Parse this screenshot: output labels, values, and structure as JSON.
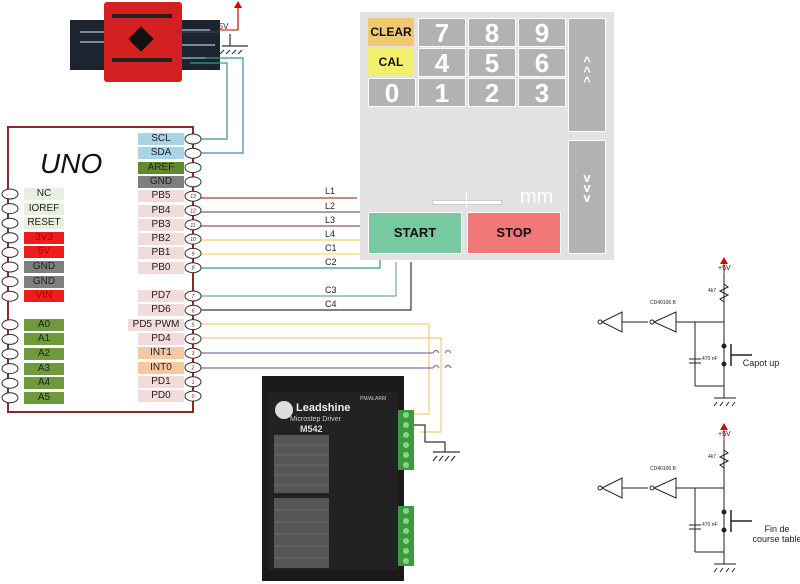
{
  "board": {
    "title": "UNO"
  },
  "left_pins": [
    {
      "label": "NC",
      "color": "#e8efe0",
      "text": "#222"
    },
    {
      "label": "IOREF",
      "color": "#e8efe0",
      "text": "#222"
    },
    {
      "label": "RESET",
      "color": "#e8efe0",
      "text": "#222"
    },
    {
      "label": "3V3",
      "color": "#ee1c1c",
      "text": "#a00"
    },
    {
      "label": "5V",
      "color": "#ee1c1c",
      "text": "#a00"
    },
    {
      "label": "GND",
      "color": "#7f7f7f",
      "text": "#222"
    },
    {
      "label": "GND",
      "color": "#7f7f7f",
      "text": "#222"
    },
    {
      "label": "VIN",
      "color": "#ee1c1c",
      "text": "#a00"
    },
    {
      "label": "A0",
      "color": "#6e9a3c",
      "text": "#222"
    },
    {
      "label": "A1",
      "color": "#6e9a3c",
      "text": "#222"
    },
    {
      "label": "A2",
      "color": "#6e9a3c",
      "text": "#222"
    },
    {
      "label": "A3",
      "color": "#6e9a3c",
      "text": "#222"
    },
    {
      "label": "A4",
      "color": "#6e9a3c",
      "text": "#222"
    },
    {
      "label": "A5",
      "color": "#6e9a3c",
      "text": "#222"
    }
  ],
  "right_pins": [
    {
      "label": "SCL",
      "color": "#a8d4e6",
      "num": ""
    },
    {
      "label": "SDA",
      "color": "#a8d4e6",
      "num": ""
    },
    {
      "label": "AREF",
      "color": "#5f8a2e",
      "num": ""
    },
    {
      "label": "GND",
      "color": "#7f7f7f",
      "num": ""
    },
    {
      "label": "PB5",
      "color": "#f2dcdb",
      "num": "13"
    },
    {
      "label": "PB4",
      "color": "#f2dcdb",
      "num": "12"
    },
    {
      "label": "PB3",
      "color": "#f2dcdb",
      "num": "11"
    },
    {
      "label": "PB2",
      "color": "#f2dcdb",
      "num": "10"
    },
    {
      "label": "PB1",
      "color": "#f2dcdb",
      "num": "9"
    },
    {
      "label": "PB0",
      "color": "#f2dcdb",
      "num": "8"
    },
    {
      "label": "PD7",
      "color": "#f2dcdb",
      "num": "7"
    },
    {
      "label": "PD6",
      "color": "#f2dcdb",
      "num": "6"
    },
    {
      "label": "PD5 PWM",
      "color": "#f2dcdb",
      "num": "5"
    },
    {
      "label": "PD4",
      "color": "#f2dcdb",
      "num": "4"
    },
    {
      "label": "INT1",
      "color": "#f8c9a0",
      "num": "3"
    },
    {
      "label": "INT0",
      "color": "#f8c9a0",
      "num": "2"
    },
    {
      "label": "PD1",
      "color": "#f2dcdb",
      "num": "1"
    },
    {
      "label": "PD0",
      "color": "#f2dcdb",
      "num": "0"
    }
  ],
  "wires": {
    "labels": [
      "L1",
      "L2",
      "L3",
      "L4",
      "C1",
      "C2",
      "C3",
      "C4"
    ],
    "colors": {
      "L1": "#b03a3a",
      "L2": "#6a6a8a",
      "L3": "#8a5a6a",
      "L4": "#f0d860",
      "C1": "#f0e870",
      "C2": "#3a9a7a",
      "C3": "#7aa0b0",
      "C4": "#2a3a4a",
      "scl": "#3a8aaa",
      "sda": "#3a9a7a",
      "pwm": "#f0d070",
      "int": "#8a70a0"
    }
  },
  "keypad": {
    "clear": "CLEAR",
    "cal": "CAL",
    "keys": [
      "7",
      "8",
      "9",
      "4",
      "5",
      "6",
      "0",
      "1",
      "2",
      "3"
    ],
    "up": "^\n^\n^",
    "down": "v\nv\nv",
    "unit": "mm",
    "start": "START",
    "stop": "STOP",
    "colors": {
      "clear": "#f0c870",
      "cal": "#f2ee70",
      "start": "#78c8a0",
      "stop": "#f07878",
      "key": "#b2b2b2",
      "panel": "#e2e2e2"
    }
  },
  "sensor_board": {
    "brand": "sparkfun",
    "supply": "+5V"
  },
  "driver": {
    "brand": "Leadshine",
    "subtitle": "Microstep Driver",
    "model": "M542",
    "header": "PM/ALARM"
  },
  "circuits": [
    {
      "supply": "+5V",
      "resistor": "4k7",
      "chip": "CD40106 B",
      "capacitor": "470 nF",
      "switch": "Capot up"
    },
    {
      "supply": "+5V",
      "resistor": "4k7",
      "chip": "CD40106 B",
      "capacitor": "470 nF",
      "switch": "Fin de course table"
    }
  ]
}
